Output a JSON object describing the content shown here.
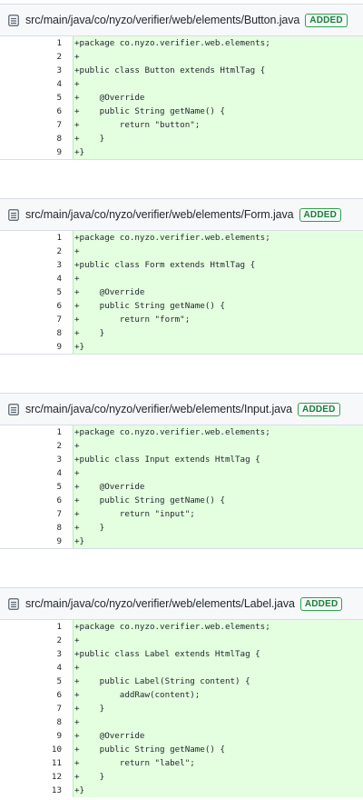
{
  "files": [
    {
      "path": "src/main/java/co/nyzo/verifier/web/elements/Button.java",
      "status": "ADDED",
      "icon": "file-diff-icon",
      "lines": [
        {
          "n": "1",
          "code": "+package co.nyzo.verifier.web.elements;"
        },
        {
          "n": "2",
          "code": "+"
        },
        {
          "n": "3",
          "code": "+public class Button extends HtmlTag {"
        },
        {
          "n": "4",
          "code": "+"
        },
        {
          "n": "5",
          "code": "+    @Override"
        },
        {
          "n": "6",
          "code": "+    public String getName() {"
        },
        {
          "n": "7",
          "code": "+        return \"button\";"
        },
        {
          "n": "8",
          "code": "+    }"
        },
        {
          "n": "9",
          "code": "+}"
        }
      ]
    },
    {
      "path": "src/main/java/co/nyzo/verifier/web/elements/Form.java",
      "status": "ADDED",
      "icon": "file-diff-icon",
      "lines": [
        {
          "n": "1",
          "code": "+package co.nyzo.verifier.web.elements;"
        },
        {
          "n": "2",
          "code": "+"
        },
        {
          "n": "3",
          "code": "+public class Form extends HtmlTag {"
        },
        {
          "n": "4",
          "code": "+"
        },
        {
          "n": "5",
          "code": "+    @Override"
        },
        {
          "n": "6",
          "code": "+    public String getName() {"
        },
        {
          "n": "7",
          "code": "+        return \"form\";"
        },
        {
          "n": "8",
          "code": "+    }"
        },
        {
          "n": "9",
          "code": "+}"
        }
      ]
    },
    {
      "path": "src/main/java/co/nyzo/verifier/web/elements/Input.java",
      "status": "ADDED",
      "icon": "file-diff-icon",
      "lines": [
        {
          "n": "1",
          "code": "+package co.nyzo.verifier.web.elements;"
        },
        {
          "n": "2",
          "code": "+"
        },
        {
          "n": "3",
          "code": "+public class Input extends HtmlTag {"
        },
        {
          "n": "4",
          "code": "+"
        },
        {
          "n": "5",
          "code": "+    @Override"
        },
        {
          "n": "6",
          "code": "+    public String getName() {"
        },
        {
          "n": "7",
          "code": "+        return \"input\";"
        },
        {
          "n": "8",
          "code": "+    }"
        },
        {
          "n": "9",
          "code": "+}"
        }
      ]
    },
    {
      "path": "src/main/java/co/nyzo/verifier/web/elements/Label.java",
      "status": "ADDED",
      "icon": "file-diff-icon",
      "lines": [
        {
          "n": "1",
          "code": "+package co.nyzo.verifier.web.elements;"
        },
        {
          "n": "2",
          "code": "+"
        },
        {
          "n": "3",
          "code": "+public class Label extends HtmlTag {"
        },
        {
          "n": "4",
          "code": "+"
        },
        {
          "n": "5",
          "code": "+    public Label(String content) {"
        },
        {
          "n": "6",
          "code": "+        addRaw(content);"
        },
        {
          "n": "7",
          "code": "+    }"
        },
        {
          "n": "8",
          "code": "+"
        },
        {
          "n": "9",
          "code": "+    @Override"
        },
        {
          "n": "10",
          "code": "+    public String getName() {"
        },
        {
          "n": "11",
          "code": "+        return \"label\";"
        },
        {
          "n": "12",
          "code": "+    }"
        },
        {
          "n": "13",
          "code": "+}"
        }
      ]
    }
  ]
}
